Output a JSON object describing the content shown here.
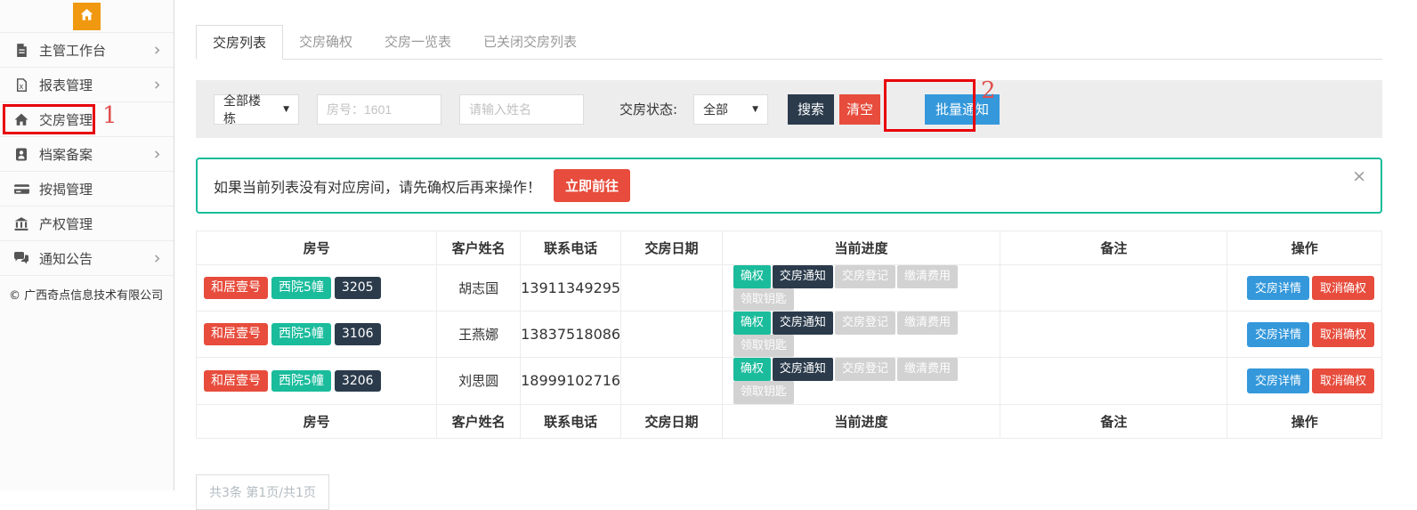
{
  "palette": {
    "orange": "#f0980f",
    "teal": "#1abc9c",
    "dark_navy": "#2b3b4c",
    "red": "#e74c3c",
    "blue": "#3498db",
    "annotation_red": "#e8000a"
  },
  "sidebar": {
    "items": [
      {
        "label": "主管工作台",
        "icon": "document-icon",
        "chevron": true
      },
      {
        "label": "报表管理",
        "icon": "report-icon",
        "chevron": true
      },
      {
        "label": "交房管理",
        "icon": "home-icon",
        "chevron": false
      },
      {
        "label": "档案备案",
        "icon": "archive-icon",
        "chevron": true
      },
      {
        "label": "按揭管理",
        "icon": "bankcard-icon",
        "chevron": false
      },
      {
        "label": "产权管理",
        "icon": "bank-icon",
        "chevron": false
      },
      {
        "label": "通知公告",
        "icon": "comment-icon",
        "chevron": true
      }
    ],
    "copyright": "© 广西奇点信息技术有限公司"
  },
  "tabs": [
    {
      "label": "交房列表",
      "active": true
    },
    {
      "label": "交房确权",
      "active": false
    },
    {
      "label": "交房一览表",
      "active": false
    },
    {
      "label": "已关闭交房列表",
      "active": false
    }
  ],
  "filters": {
    "building_select": "全部楼栋",
    "room_placeholder": "房号：1601",
    "name_placeholder": "请输入姓名",
    "status_label": "交房状态:",
    "status_select": "全部",
    "search_button": "搜索",
    "clear_button": "清空",
    "batch_notify_button": "批量通知"
  },
  "alert": {
    "message": "如果当前列表没有对应房间，请先确权后再来操作！",
    "action_button": "立即前往",
    "close": "×"
  },
  "table": {
    "headers": [
      "房号",
      "客户姓名",
      "联系电话",
      "交房日期",
      "当前进度",
      "备注",
      "操作"
    ],
    "rows": [
      {
        "tags": [
          {
            "text": "和居壹号",
            "color": "#e74c3c"
          },
          {
            "text": "西院5幢",
            "color": "#1abc9c"
          },
          {
            "text": "3205",
            "color": "#2b3b4c"
          }
        ],
        "name": "胡志国",
        "phone": "13911349295",
        "date": "",
        "remark": "",
        "progress": [
          {
            "text": "确权",
            "state": "done"
          },
          {
            "text": "交房通知",
            "state": "current"
          },
          {
            "text": "交房登记",
            "state": "pending"
          },
          {
            "text": "缴清费用",
            "state": "pending"
          },
          {
            "text": "领取钥匙",
            "state": "pending"
          }
        ],
        "actions": [
          {
            "label": "交房详情",
            "type": "primary"
          },
          {
            "label": "取消确权",
            "type": "danger"
          }
        ]
      },
      {
        "tags": [
          {
            "text": "和居壹号",
            "color": "#e74c3c"
          },
          {
            "text": "西院5幢",
            "color": "#1abc9c"
          },
          {
            "text": "3106",
            "color": "#2b3b4c"
          }
        ],
        "name": "王燕娜",
        "phone": "13837518086",
        "date": "",
        "remark": "",
        "progress": [
          {
            "text": "确权",
            "state": "done"
          },
          {
            "text": "交房通知",
            "state": "current"
          },
          {
            "text": "交房登记",
            "state": "pending"
          },
          {
            "text": "缴清费用",
            "state": "pending"
          },
          {
            "text": "领取钥匙",
            "state": "pending"
          }
        ],
        "actions": [
          {
            "label": "交房详情",
            "type": "primary"
          },
          {
            "label": "取消确权",
            "type": "danger"
          }
        ]
      },
      {
        "tags": [
          {
            "text": "和居壹号",
            "color": "#e74c3c"
          },
          {
            "text": "西院5幢",
            "color": "#1abc9c"
          },
          {
            "text": "3206",
            "color": "#2b3b4c"
          }
        ],
        "name": "刘思圆",
        "phone": "18999102716",
        "date": "",
        "remark": "",
        "progress": [
          {
            "text": "确权",
            "state": "done"
          },
          {
            "text": "交房通知",
            "state": "current"
          },
          {
            "text": "交房登记",
            "state": "pending"
          },
          {
            "text": "缴清费用",
            "state": "pending"
          },
          {
            "text": "领取钥匙",
            "state": "pending"
          }
        ],
        "actions": [
          {
            "label": "交房详情",
            "type": "primary"
          },
          {
            "label": "取消确权",
            "type": "danger"
          }
        ]
      }
    ]
  },
  "pagination": {
    "summary": "共3条 第1页/共1页"
  },
  "annotations": {
    "step1": "1",
    "step2": "2"
  }
}
